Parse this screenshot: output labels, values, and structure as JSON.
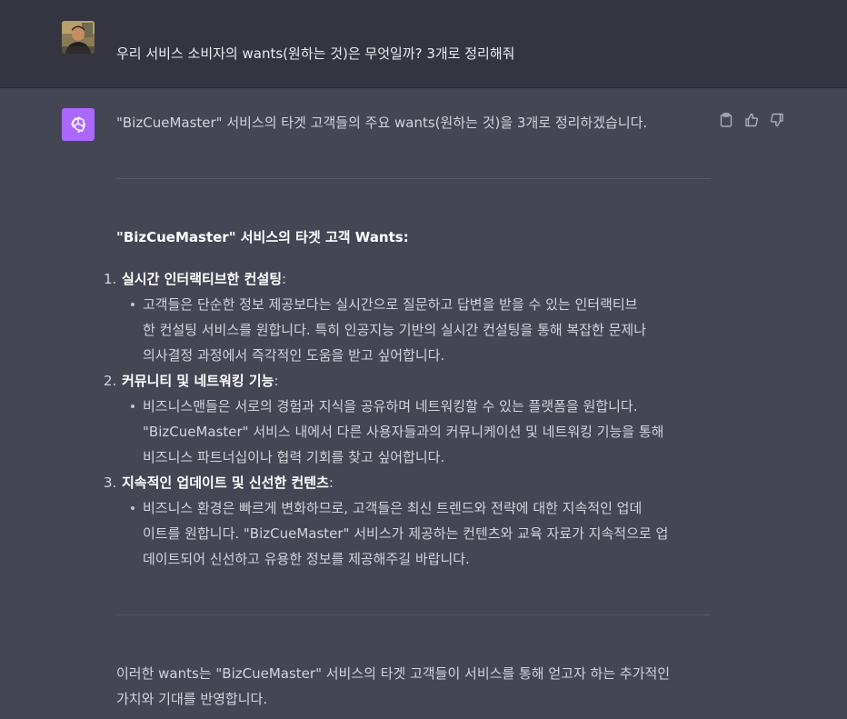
{
  "user_message": {
    "text": "우리 서비스 소비자의 wants(원하는 것)은 무엇일까? 3개로 정리해줘"
  },
  "assistant": {
    "intro": "\"BizCueMaster\" 서비스의 타겟 고객들의 주요 wants(원하는 것)을 3개로 정리하겠습니다.",
    "heading": "\"BizCueMaster\" 서비스의 타겟 고객 Wants:",
    "items": [
      {
        "num": "1.",
        "title": "실시간 인터랙티브한 컨설팅",
        "colon": ":",
        "lines": [
          "고객들은 단순한 정보 제공보다는 실시간으로 질문하고 답변을 받을 수 있는 인터랙티브",
          "한 컨설팅 서비스를 원합니다. 특히 인공지능 기반의 실시간 컨설팅을 통해 복잡한 문제나",
          "의사결정 과정에서 즉각적인 도움을 받고 싶어합니다."
        ]
      },
      {
        "num": "2.",
        "title": "커뮤니티 및 네트워킹 기능",
        "colon": ":",
        "lines": [
          "비즈니스맨들은 서로의 경험과 지식을 공유하며 네트워킹할 수 있는 플랫폼을 원합니다.",
          "\"BizCueMaster\" 서비스 내에서 다른 사용자들과의 커뮤니케이션 및 네트워킹 기능을 통해",
          "비즈니스 파트너십이나 협력 기회를 찾고 싶어합니다."
        ]
      },
      {
        "num": "3.",
        "title": "지속적인 업데이트 및 신선한 컨텐츠",
        "colon": ":",
        "lines": [
          "비즈니스 환경은 빠르게 변화하므로, 고객들은 최신 트렌드와 전략에 대한 지속적인 업데",
          "이트를 원합니다. \"BizCueMaster\" 서비스가 제공하는 컨텐츠와 교육 자료가 지속적으로 업",
          "데이트되어 신선하고 유용한 정보를 제공해주길 바랍니다."
        ]
      }
    ],
    "outro_lines": [
      "이러한 wants는 \"BizCueMaster\" 서비스의 타겟 고객들이 서비스를 통해 얻고자 하는 추가적인",
      "가치와 기대를 반영합니다."
    ]
  },
  "icons": {
    "avatar": "user-avatar-photo",
    "assistant": "openai-logo-icon",
    "copy": "clipboard-icon",
    "like": "thumbs-up-icon",
    "dislike": "thumbs-down-icon"
  },
  "colors": {
    "user_bg": "#343541",
    "assistant_bg": "#444654",
    "assistant_icon_bg": "#ab68ff"
  }
}
